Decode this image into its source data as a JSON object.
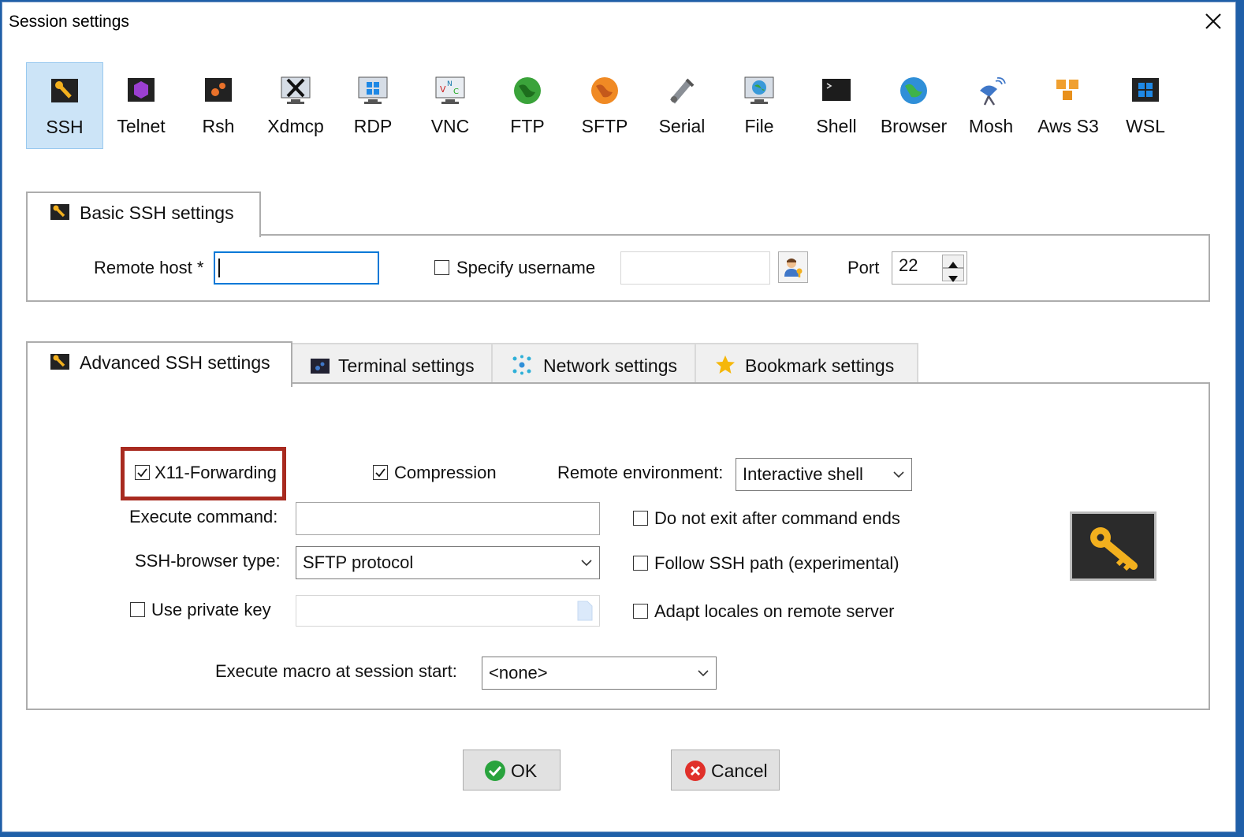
{
  "window": {
    "title": "Session settings"
  },
  "protocols": [
    {
      "label": "SSH",
      "icon": "ssh-icon",
      "selected": true
    },
    {
      "label": "Telnet",
      "icon": "telnet-icon"
    },
    {
      "label": "Rsh",
      "icon": "rsh-icon"
    },
    {
      "label": "Xdmcp",
      "icon": "xdmcp-icon"
    },
    {
      "label": "RDP",
      "icon": "rdp-icon"
    },
    {
      "label": "VNC",
      "icon": "vnc-icon"
    },
    {
      "label": "FTP",
      "icon": "ftp-icon"
    },
    {
      "label": "SFTP",
      "icon": "sftp-icon"
    },
    {
      "label": "Serial",
      "icon": "serial-icon"
    },
    {
      "label": "File",
      "icon": "file-icon"
    },
    {
      "label": "Shell",
      "icon": "shell-icon"
    },
    {
      "label": "Browser",
      "icon": "browser-icon"
    },
    {
      "label": "Mosh",
      "icon": "mosh-icon"
    },
    {
      "label": "Aws S3",
      "icon": "aws-s3-icon"
    },
    {
      "label": "WSL",
      "icon": "wsl-icon"
    }
  ],
  "basic": {
    "tab_label": "Basic SSH settings",
    "remote_host_label": "Remote host *",
    "remote_host_value": "",
    "specify_username_label": "Specify username",
    "specify_username_checked": false,
    "username_value": "",
    "port_label": "Port",
    "port_value": "22"
  },
  "tabs": [
    {
      "label": "Advanced SSH settings",
      "icon": "wrench-icon",
      "active": true
    },
    {
      "label": "Terminal settings",
      "icon": "terminal-icon"
    },
    {
      "label": "Network settings",
      "icon": "network-icon"
    },
    {
      "label": "Bookmark settings",
      "icon": "star-icon"
    }
  ],
  "advanced": {
    "x11_label": "X11-Forwarding",
    "x11_checked": true,
    "compression_label": "Compression",
    "compression_checked": true,
    "remote_env_label": "Remote environment:",
    "remote_env_value": "Interactive shell",
    "execute_command_label": "Execute command:",
    "execute_command_value": "",
    "do_not_exit_label": "Do not exit after command ends",
    "browser_type_label": "SSH-browser type:",
    "browser_type_value": "SFTP protocol",
    "follow_path_label": "Follow SSH path (experimental)",
    "use_private_key_label": "Use private key",
    "private_key_value": "",
    "adapt_locales_label": "Adapt locales on remote server",
    "macro_label": "Execute macro at session start:",
    "macro_value": "<none>"
  },
  "buttons": {
    "ok": "OK",
    "cancel": "Cancel"
  },
  "colors": {
    "selection": "#cce4f7",
    "focus": "#0078d7",
    "highlight": "#a82a1f"
  }
}
